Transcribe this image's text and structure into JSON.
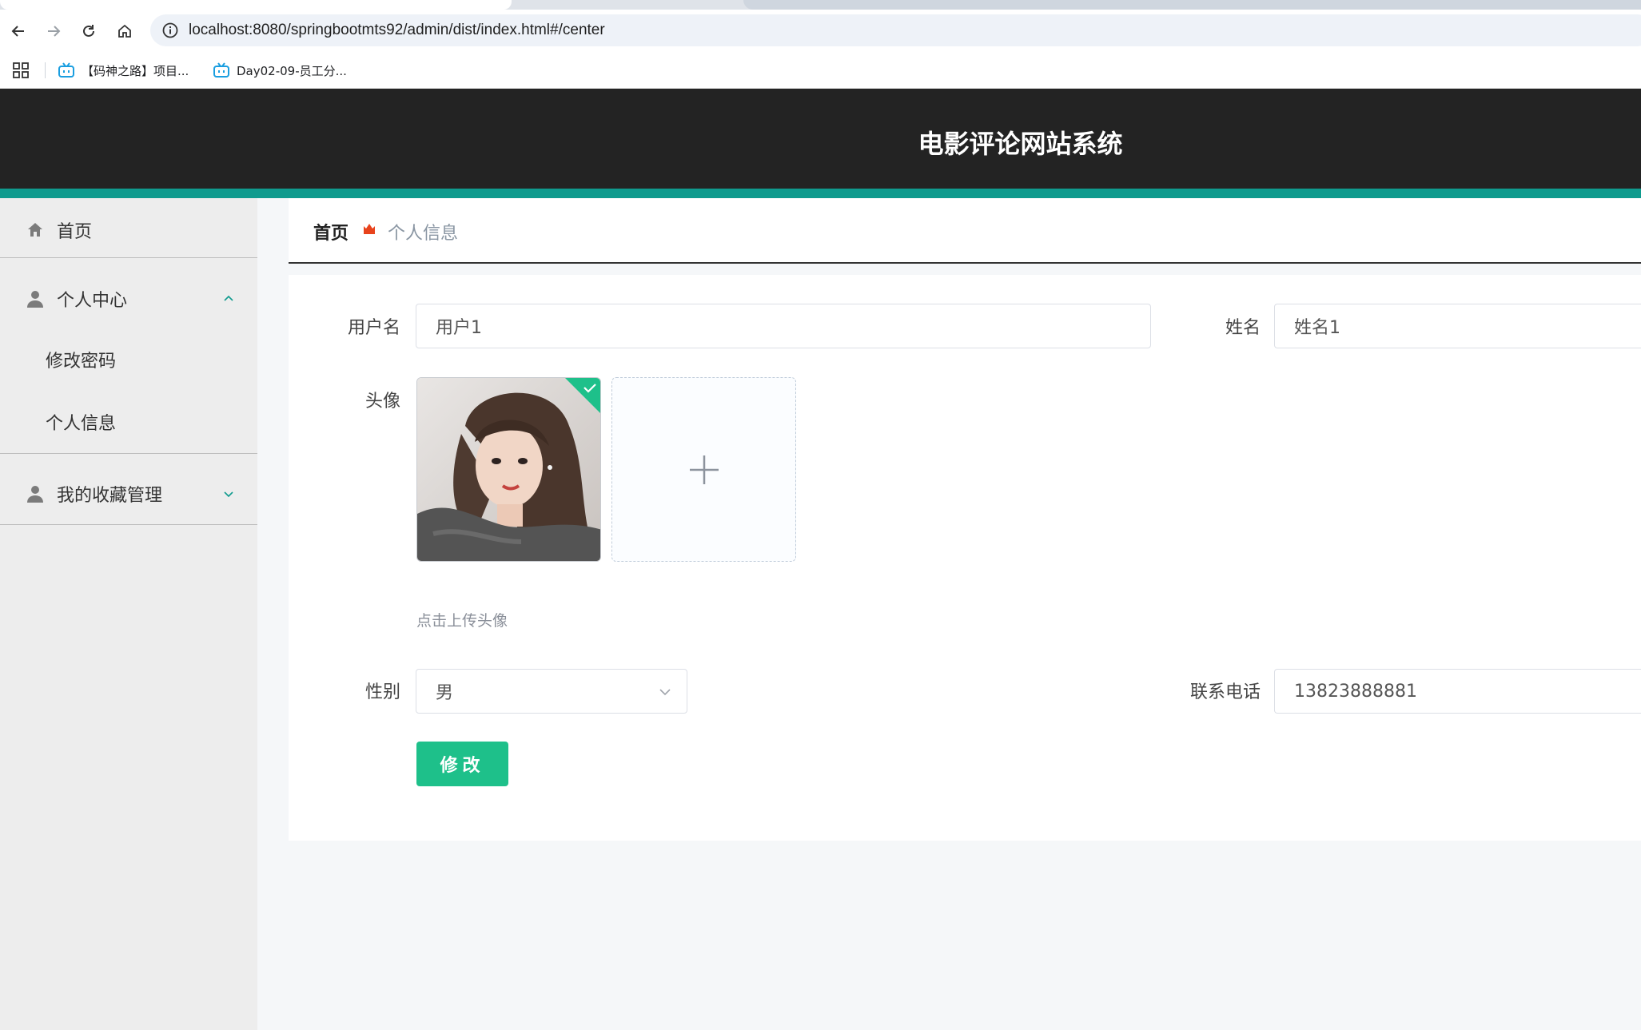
{
  "browser": {
    "url": "localhost:8080/springbootmts92/admin/dist/index.html#/center",
    "bookmarks": [
      {
        "label": "【码神之路】项目..."
      },
      {
        "label": "Day02-09-员工分..."
      }
    ]
  },
  "header": {
    "title": "电影评论网站系统",
    "accent_color": "#0f9b8e",
    "bg_color": "#232323"
  },
  "sidebar": {
    "home": "首页",
    "personal_center": "个人中心",
    "change_password": "修改密码",
    "personal_info": "个人信息",
    "my_favorites": "我的收藏管理"
  },
  "breadcrumb": {
    "home": "首页",
    "current": "个人信息"
  },
  "form": {
    "username_label": "用户名",
    "username_value": "用户1",
    "name_label": "姓名",
    "name_value": "姓名1",
    "avatar_label": "头像",
    "upload_tip": "点击上传头像",
    "gender_label": "性别",
    "gender_value": "男",
    "phone_label": "联系电话",
    "phone_value": "13823888881",
    "submit_label": "修改",
    "submit_color": "#1ec08a"
  }
}
